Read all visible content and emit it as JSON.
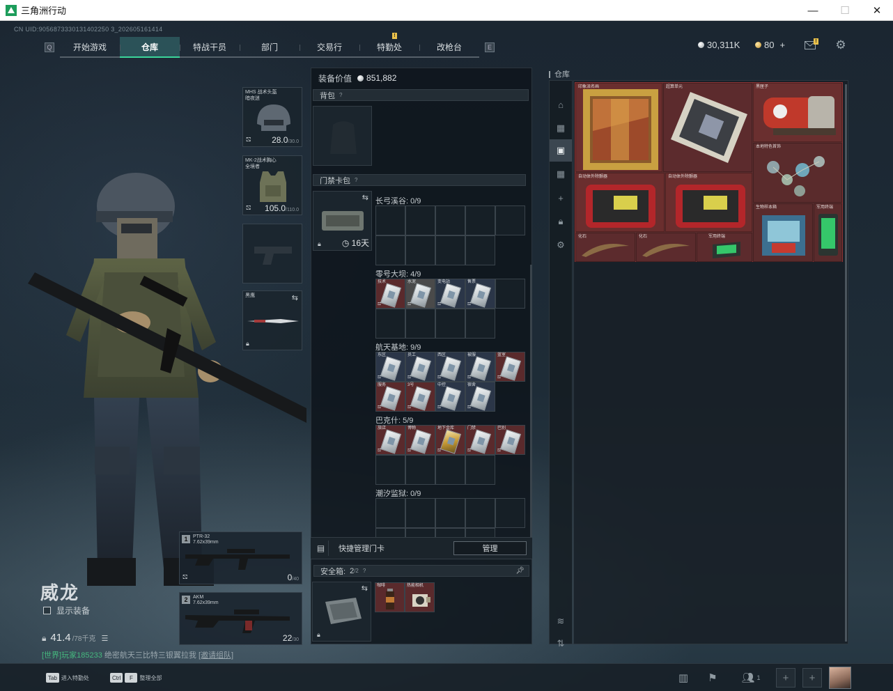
{
  "window": {
    "title": "三角洲行动",
    "controls": {
      "minimize": "—",
      "maximize": "☐",
      "close": "✕"
    }
  },
  "uid": "CN UID:9056873330131402250 3_202605161414",
  "nav": {
    "tabs": [
      {
        "label": "开始游戏",
        "active": false
      },
      {
        "label": "仓库",
        "active": true
      },
      {
        "label": "特战干员",
        "active": false
      },
      {
        "label": "部门",
        "active": false
      },
      {
        "label": "交易行",
        "active": false
      },
      {
        "label": "特勤处",
        "active": false,
        "badge": "!"
      },
      {
        "label": "改枪台",
        "active": false
      }
    ],
    "left_key": "Q",
    "right_key": "E"
  },
  "currency": {
    "silver": "30,311K",
    "gold": "80",
    "gold_add": "+",
    "mail_badge": "!"
  },
  "operator": {
    "name": "威龙",
    "show_equip_label": "显示装备",
    "weight": "41.4",
    "weight_max": "/78千克"
  },
  "chat": {
    "channel": "[世界]",
    "player": "玩家185233",
    "message": " 绝密航天三比特三银翼拉我 ",
    "link": "[邀请组队]"
  },
  "equip_slots": {
    "helmet": {
      "label": "MHS 战术头盔\n暗夜迷",
      "value": "28.0",
      "max": "/30.0"
    },
    "armor": {
      "label": "MK-2战术胸心\n全境者",
      "value": "105.0",
      "max": "/110.0"
    },
    "melee": {
      "label": "黑鹰"
    }
  },
  "weapons": [
    {
      "num": "1",
      "name": "PTR-32",
      "caliber": "7.62x39mm",
      "ammo": "0",
      "ammo_max": "/40"
    },
    {
      "num": "2",
      "name": "AKM",
      "caliber": "7.62x39mm",
      "ammo": "22",
      "ammo_max": "/30"
    }
  ],
  "middle": {
    "value_label": "装备价值",
    "value": "851,882",
    "backpack_label": "背包",
    "card_pack_label": "门禁卡包",
    "card_pack_days": "16天",
    "maps": [
      {
        "title": "长弓溪谷: 0/9",
        "cards": []
      },
      {
        "title": "零号大坝: 4/9",
        "cards": [
          {
            "label": "技术",
            "tone": "red"
          },
          {
            "label": "水泥",
            "tone": "plain"
          },
          {
            "label": "变电站",
            "tone": "blue"
          },
          {
            "label": "售票",
            "tone": "blue"
          }
        ]
      },
      {
        "title": "航天基地: 9/9",
        "cards": [
          {
            "label": "东区",
            "tone": "blue"
          },
          {
            "label": "员工",
            "tone": "blue"
          },
          {
            "label": "西区",
            "tone": "blue"
          },
          {
            "label": "被服",
            "tone": "blue"
          },
          {
            "label": "蓝室",
            "tone": "red"
          },
          {
            "label": "服务",
            "tone": "red"
          },
          {
            "label": "3号",
            "tone": "red"
          },
          {
            "label": "中控",
            "tone": "blue"
          },
          {
            "label": "宿舍",
            "tone": "blue"
          }
        ]
      },
      {
        "title": "巴克什: 5/9",
        "cards": [
          {
            "label": "旅店",
            "tone": "red"
          },
          {
            "label": "博物",
            "tone": "red"
          },
          {
            "label": "地下金库",
            "tone": "red",
            "gold": true
          },
          {
            "label": "门禁",
            "tone": "red"
          },
          {
            "label": "巴别",
            "tone": "red"
          }
        ]
      },
      {
        "title": "潮汐监狱: 0/9",
        "cards": []
      }
    ],
    "quick_manage_label": "快捷管理门卡",
    "manage_button": "管理",
    "safe_box_label": "安全箱:",
    "safe_box_count": "2",
    "safe_box_max": "/2",
    "safe_items": [
      {
        "label": "咖啡"
      },
      {
        "label": "热能相机"
      }
    ]
  },
  "storage": {
    "title": "仓库",
    "items": [
      {
        "label": "印象派名画",
        "color": "#6a2e2e"
      },
      {
        "label": "超算单元",
        "color": "#5c2b2d"
      },
      {
        "label": "黑匣子",
        "color": "#6a2f2f"
      },
      {
        "label": "本地特色首饰",
        "color": "#5a2b2c"
      },
      {
        "label": "自动体外除颤器",
        "color": "#6a2e2e"
      },
      {
        "label": "自动体外除颤器",
        "color": "#6a2e2e"
      },
      {
        "label": "生物样本箱",
        "color": "#5a2b2c"
      },
      {
        "label": "军用终端",
        "color": "#5a2b2c"
      },
      {
        "label": "化石",
        "color": "#5c2b2d"
      },
      {
        "label": "化石",
        "color": "#5c2b2d"
      },
      {
        "label": "军用终端",
        "color": "#5c2b2d"
      }
    ]
  },
  "bottom": {
    "hint1_key": "Tab",
    "hint1_text": "进入特勤处",
    "hint2_key1": "Ctrl",
    "hint2_key2": "F",
    "hint2_text": "整理全部",
    "friends_count": "1"
  }
}
